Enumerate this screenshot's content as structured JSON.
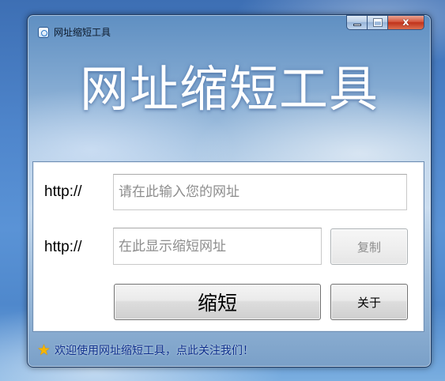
{
  "window": {
    "title": "网址缩短工具",
    "close_glyph": "x",
    "icons": {
      "app": "app-icon",
      "minimize": "minimize-icon",
      "maximize": "maximize-icon",
      "close": "close-icon"
    }
  },
  "banner": {
    "text": "网址缩短工具"
  },
  "form": {
    "input_row": {
      "prefix": "http://",
      "placeholder": "请在此输入您的网址",
      "value": ""
    },
    "output_row": {
      "prefix": "http://",
      "placeholder": "在此显示缩短网址",
      "value": "",
      "copy_label": "复制"
    },
    "shorten_label": "缩短",
    "about_label": "关于"
  },
  "status": {
    "icon": "star-icon",
    "text": "欢迎使用网址缩短工具，点此关注我们！"
  },
  "colors": {
    "link_text": "#0b2e8c",
    "star": "#f7b500",
    "close_button": "#c0321b"
  }
}
